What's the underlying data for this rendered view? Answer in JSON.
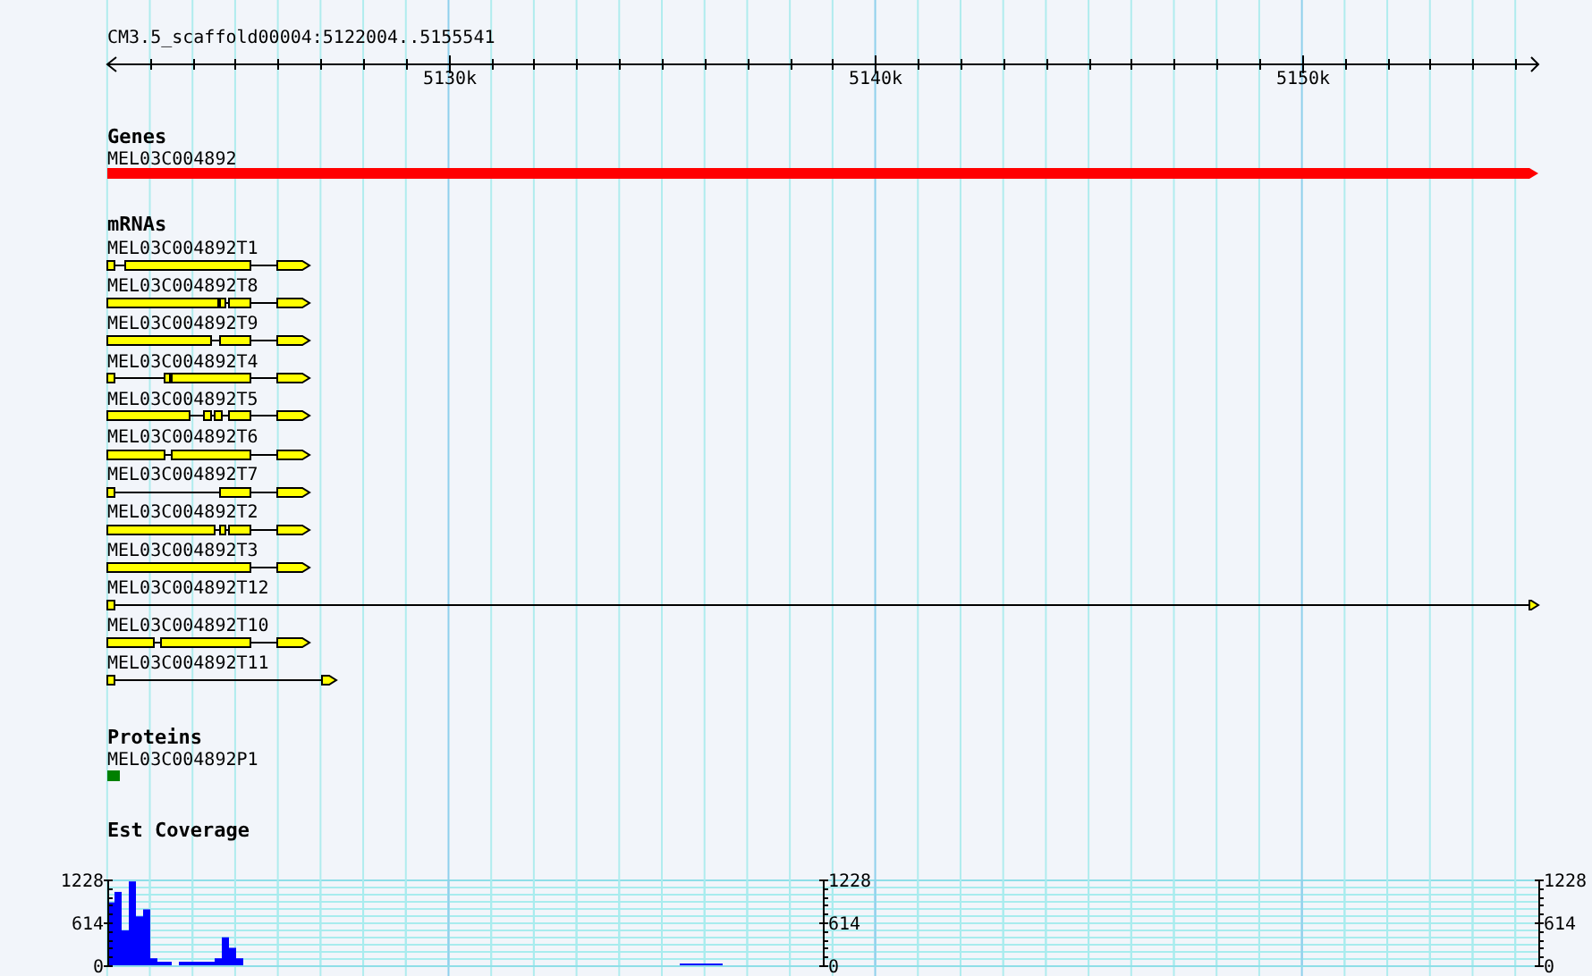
{
  "ruler": {
    "title": "CM3.5_scaffold00004:5122004..5155541",
    "ticks": [
      {
        "label": "5130k"
      },
      {
        "label": "5140k"
      },
      {
        "label": "5150k"
      }
    ]
  },
  "tracks": [
    {
      "kind": "gene",
      "title": "Genes",
      "features": [
        {
          "name": "MEL03C004892"
        }
      ]
    },
    {
      "kind": "mrna",
      "title": "mRNAs",
      "features": [
        {
          "name": "MEL03C004892T1"
        },
        {
          "name": "MEL03C004892T8"
        },
        {
          "name": "MEL03C004892T9"
        },
        {
          "name": "MEL03C004892T4"
        },
        {
          "name": "MEL03C004892T5"
        },
        {
          "name": "MEL03C004892T6"
        },
        {
          "name": "MEL03C004892T7"
        },
        {
          "name": "MEL03C004892T2"
        },
        {
          "name": "MEL03C004892T3"
        },
        {
          "name": "MEL03C004892T12"
        },
        {
          "name": "MEL03C004892T10"
        },
        {
          "name": "MEL03C004892T11"
        }
      ]
    },
    {
      "kind": "protein",
      "title": "Proteins",
      "features": [
        {
          "name": "MEL03C004892P1"
        }
      ]
    },
    {
      "kind": "coverage",
      "title": "Est Coverage",
      "axis_labels": [
        {
          "ticks": [
            "1228",
            "614",
            "0"
          ]
        },
        {
          "ticks": [
            "1228",
            "614",
            "0"
          ]
        }
      ],
      "chart_data": {
        "type": "bar",
        "grid": true,
        "ylim": [
          0,
          1228
        ],
        "yticks": [
          {
            "value": 1228,
            "label": "1228"
          },
          {
            "value": 614,
            "label": "614"
          },
          {
            "value": 0,
            "label": "0"
          }
        ],
        "series": [
          {
            "color": "#0000ff",
            "values": [
              900,
              1050,
              500,
              1200,
              700,
              800,
              100,
              50,
              50,
              0,
              50,
              50,
              50,
              50,
              50,
              100,
              400,
              250,
              100,
              0,
              0,
              0,
              0,
              0,
              0,
              0,
              0,
              0,
              0,
              0,
              0,
              0,
              0,
              0,
              0,
              0,
              0,
              0,
              0,
              0,
              0,
              0,
              0,
              0,
              0,
              0,
              0,
              0,
              0,
              0,
              0,
              0,
              0,
              0,
              0,
              0,
              0,
              0,
              0,
              0,
              0,
              0,
              0,
              0,
              0,
              0,
              0,
              0,
              0,
              0,
              0,
              0,
              0,
              0,
              0,
              0,
              0,
              0,
              0,
              0,
              25,
              25,
              25,
              25,
              25,
              25,
              0,
              0,
              0,
              0,
              0,
              0,
              0,
              0,
              0,
              0,
              0,
              0,
              0,
              0,
              0,
              0,
              0,
              0,
              0,
              0,
              0,
              0,
              0,
              0,
              0,
              0,
              0,
              0,
              0,
              0,
              0,
              0,
              0,
              0,
              0,
              0,
              0,
              0,
              0,
              0,
              0,
              0,
              0,
              0,
              0,
              0,
              0,
              0,
              0,
              0,
              0,
              0,
              0,
              0,
              0,
              0,
              0,
              0,
              0,
              0,
              0,
              0,
              0,
              0,
              0,
              0,
              0,
              0,
              0,
              0,
              0,
              0,
              0,
              0,
              0,
              0,
              0,
              0,
              0,
              0,
              0,
              0,
              0,
              0,
              0,
              0,
              0,
              0,
              0,
              0,
              0,
              0,
              0,
              0,
              0,
              0,
              0,
              0,
              0,
              0,
              0,
              0,
              0,
              0,
              0,
              0,
              0,
              0,
              0,
              0,
              0,
              0,
              0,
              0
            ]
          }
        ]
      }
    }
  ]
}
